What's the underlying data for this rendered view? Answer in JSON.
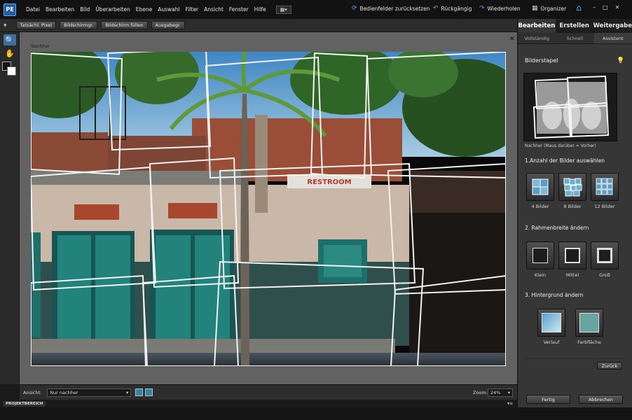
{
  "menubar": {
    "logo": "PE",
    "menus": [
      "Datei",
      "Bearbeiten",
      "Bild",
      "Überarbeiten",
      "Ebene",
      "Auswahl",
      "Filter",
      "Ansicht",
      "Fenster",
      "Hilfe"
    ],
    "view_icon": "layout-grid-icon",
    "reset_panels": "Bedienfelder zurücksetzen",
    "undo": "Rückgängig",
    "redo": "Wiederholen",
    "organizer": "Organizer",
    "window_minimize": "–",
    "window_maximize": "□",
    "window_close": "✕"
  },
  "options_bar": {
    "buttons": [
      "Tatsächl. Pixel",
      "Bildschirmgr.",
      "Bildschirm füllen",
      "Ausgabegr."
    ]
  },
  "document": {
    "tab_title": "Nachher",
    "close": "✕",
    "sign_text": "RESTROOM"
  },
  "status_bar": {
    "view_label": "Ansicht:",
    "view_value": "Nur nachher",
    "zoom_label": "Zoom:",
    "zoom_value": "24%"
  },
  "project_bin": {
    "label": "PROJEKTBEREICH"
  },
  "panel": {
    "tabs": [
      {
        "label": "Bearbeiten",
        "active": true
      },
      {
        "label": "Erstellen",
        "active": false
      },
      {
        "label": "Weitergabe",
        "active": false
      }
    ],
    "subtabs": [
      {
        "label": "Vollständig",
        "active": false
      },
      {
        "label": "Schnell",
        "active": false
      },
      {
        "label": "Assistent",
        "active": true
      }
    ],
    "title": "Bilderstapel",
    "preview_caption": "Nachher (Maus darüber = Vorher)",
    "step1": "1.Anzahl der Bilder auswählen",
    "count_options": [
      "4 Bilder",
      "8 Bilder",
      "12 Bilder"
    ],
    "step2": "2. Rahmenbreite ändern",
    "frame_options": [
      "Klein",
      "Mittel",
      "Groß"
    ],
    "step3": "3. Hintergrund ändern",
    "background_options": [
      "Verlauf",
      "Farbfläche"
    ],
    "reset": "Zurück",
    "done": "Fertig",
    "cancel": "Abbrechen"
  },
  "colors": {
    "accent": "#5aa0e6",
    "teal_door": "#1f7f7a",
    "gradient_swatch": "#86c2e0",
    "solid_swatch": "#6aa4a0"
  }
}
